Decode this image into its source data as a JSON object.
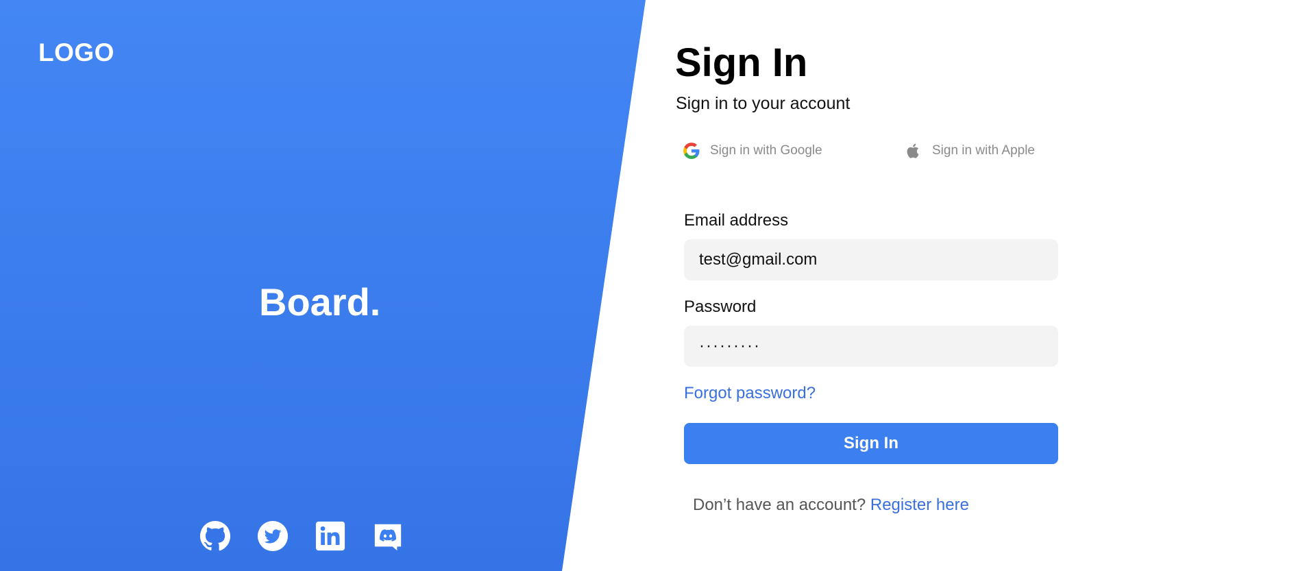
{
  "brand": {
    "logo_text": "LOGO",
    "tagline": "Board."
  },
  "social_icons": [
    "github-icon",
    "twitter-icon",
    "linkedin-icon",
    "discord-icon"
  ],
  "form": {
    "title": "Sign In",
    "subtitle": "Sign in to your account",
    "google_label": "Sign in with Google",
    "apple_label": "Sign in with Apple",
    "email_label": "Email address",
    "email_value": "test@gmail.com",
    "password_label": "Password",
    "password_value": "·········",
    "forgot_label": "Forgot password?",
    "submit_label": "Sign In",
    "register_prompt": "Don’t have an account?",
    "register_link": "Register here"
  },
  "colors": {
    "primary": "#3b7ff0",
    "panel_top": "#4386f4",
    "panel_bottom": "#3574e6",
    "link": "#3a6fe0",
    "field_bg": "#f3f3f3"
  }
}
